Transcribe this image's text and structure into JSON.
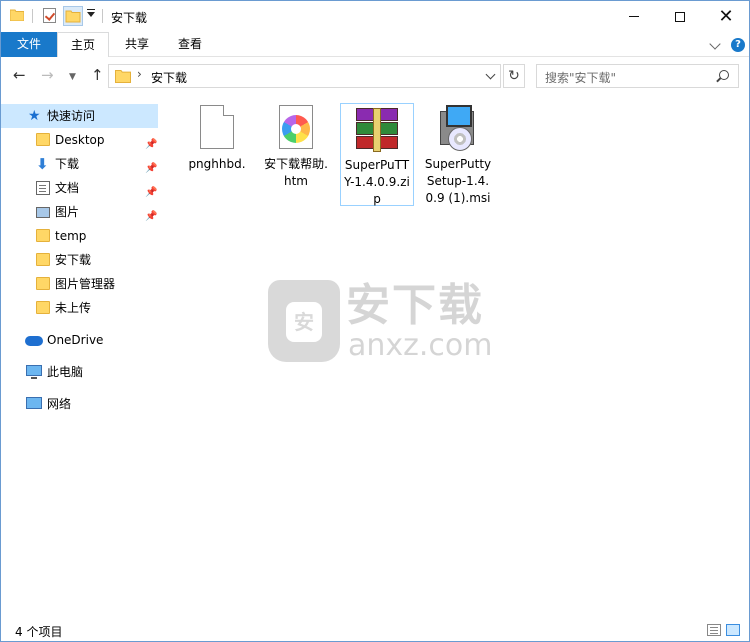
{
  "window": {
    "title": "安下载"
  },
  "ribbon": {
    "tabs": [
      {
        "label": "文件"
      },
      {
        "label": "主页"
      },
      {
        "label": "共享"
      },
      {
        "label": "查看"
      }
    ]
  },
  "nav": {
    "back": "←",
    "forward": "→",
    "up": "↑",
    "refresh": "↻",
    "address_sep": "›",
    "address": "安下载",
    "search_placeholder": "搜索\"安下载\""
  },
  "sidebar": {
    "quick_access": "快速访问",
    "items": [
      {
        "label": "Desktop",
        "icon": "folder-icon",
        "pinned": true
      },
      {
        "label": "下载",
        "icon": "download-icon",
        "pinned": true
      },
      {
        "label": "文档",
        "icon": "document-icon",
        "pinned": true
      },
      {
        "label": "图片",
        "icon": "picture-icon",
        "pinned": true
      },
      {
        "label": "temp",
        "icon": "folder-icon",
        "pinned": false
      },
      {
        "label": "安下载",
        "icon": "folder-icon",
        "pinned": false
      },
      {
        "label": "图片管理器",
        "icon": "folder-icon",
        "pinned": false
      },
      {
        "label": "未上传",
        "icon": "folder-icon",
        "pinned": false
      }
    ],
    "onedrive": "OneDrive",
    "this_pc": "此电脑",
    "network": "网络"
  },
  "files": [
    {
      "name": "pnghhbd.",
      "icon": "blank-file-icon"
    },
    {
      "name": "安下载帮助.htm",
      "icon": "htm-file-icon"
    },
    {
      "name": "SuperPuTTY-1.4.0.9.zip",
      "icon": "winrar-archive-icon",
      "selected": true
    },
    {
      "name": "SuperPuttySetup-1.4.0.9 (1).msi",
      "icon": "msi-installer-icon"
    }
  ],
  "watermark": {
    "cn": "安下载",
    "en": "anxz.com",
    "shield_glyph": "安"
  },
  "status": {
    "count": "4 个项目"
  },
  "colors": {
    "accent": "#1979ca",
    "selection": "#cce8ff",
    "folder": "#ffd766"
  }
}
